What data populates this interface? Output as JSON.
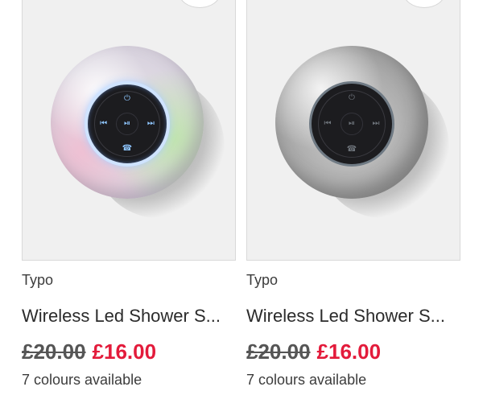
{
  "products": [
    {
      "brand": "Typo",
      "name": "Wireless Led Shower S...",
      "was_price": "£20.00",
      "price": "£16.00",
      "colours": "7 colours available",
      "variant": "iridescent",
      "controls": {
        "power": "⏻",
        "prev": "⏮",
        "play": "⏯",
        "next": "⏭",
        "call": "☎"
      }
    },
    {
      "brand": "Typo",
      "name": "Wireless Led Shower S...",
      "was_price": "£20.00",
      "price": "£16.00",
      "colours": "7 colours available",
      "variant": "silver",
      "controls": {
        "power": "⏻",
        "prev": "⏮",
        "play": "⏯",
        "next": "⏭",
        "call": "☎"
      }
    }
  ],
  "colors": {
    "sale": "#e31b3b",
    "text": "#2b2b2b",
    "image_bg": "#f0f0f0"
  }
}
